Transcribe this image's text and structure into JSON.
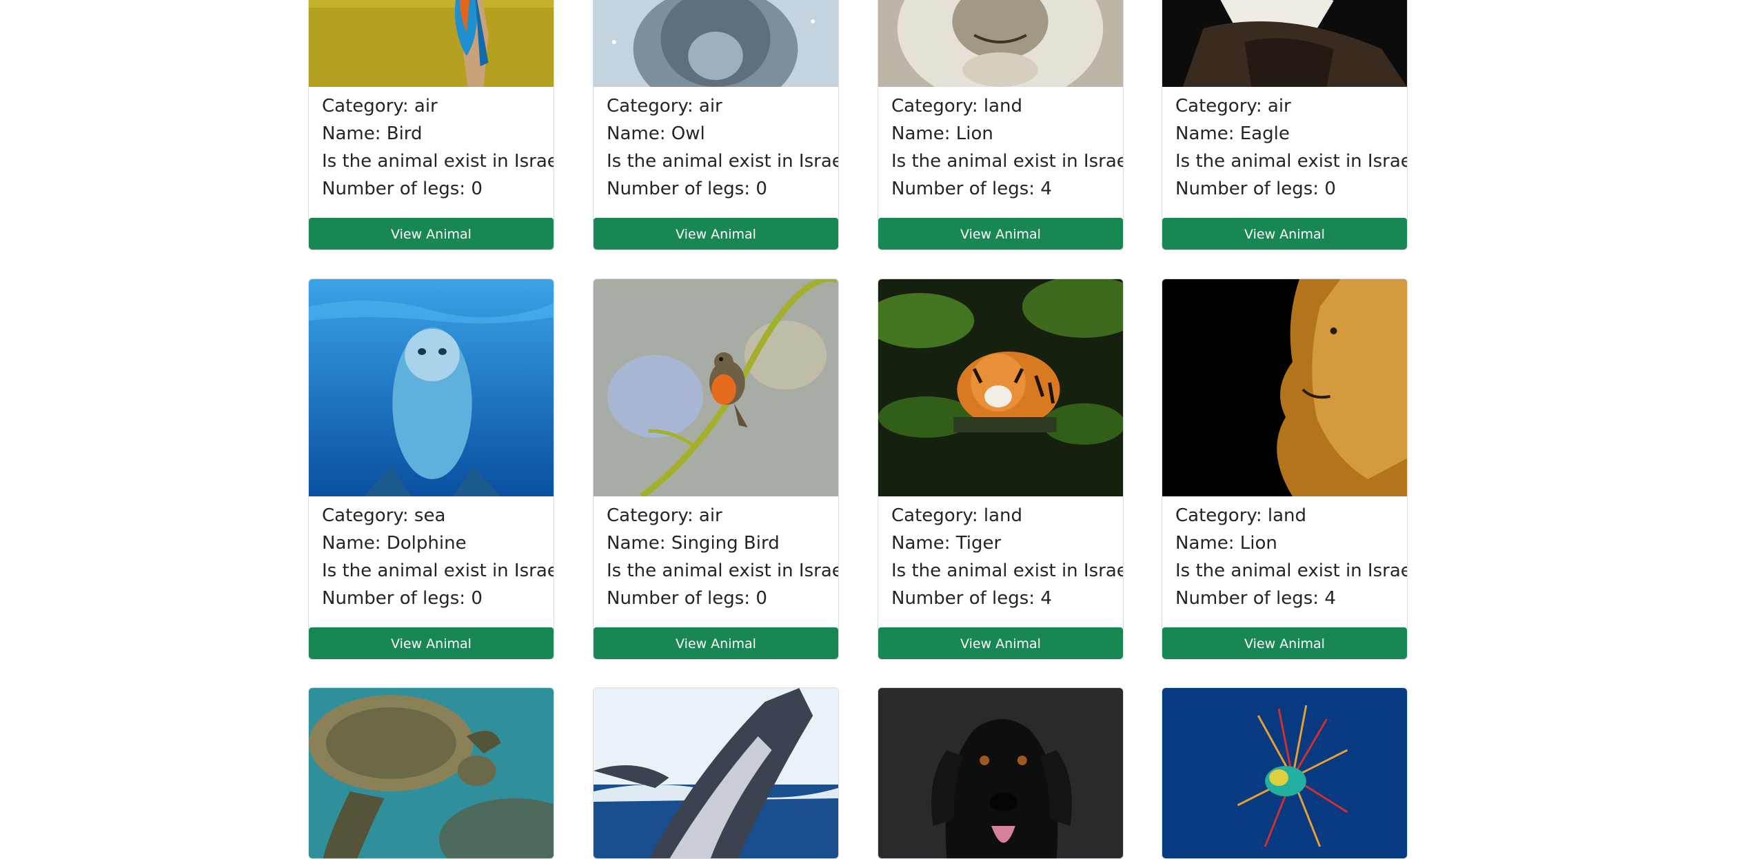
{
  "card_labels": {
    "category_prefix": "Category: ",
    "name_prefix": "Name: ",
    "exists_question": "Is the animal exist in Israel?",
    "legs_prefix": "Number of legs: ",
    "button_label": "View Animal"
  },
  "rows": [
    {
      "cards": [
        {
          "category": "Category: air",
          "name": "Name: Bird",
          "exists": "Is the animal exist in Israel?",
          "legs": "Number of legs: 0",
          "button": "View Animal",
          "image_icon": "kingfisher-bird-photo",
          "colors": [
            "#c9b52a",
            "#8a7a18"
          ]
        },
        {
          "category": "Category: air",
          "name": "Name: Owl",
          "exists": "Is the animal exist in Israel?",
          "legs": "Number of legs: 0",
          "button": "View Animal",
          "image_icon": "snowy-owl-photo",
          "colors": [
            "#b9c9d6",
            "#6c7f8e"
          ]
        },
        {
          "category": "Category: land",
          "name": "Name: Lion",
          "exists": "Is the animal exist in Israel?",
          "legs": "Number of legs: 4",
          "button": "View Animal",
          "image_icon": "lion-chin-photo",
          "colors": [
            "#d8d2c6",
            "#8a7f6e"
          ]
        },
        {
          "category": "Category: air",
          "name": "Name: Eagle",
          "exists": "Is the animal exist in Israel?",
          "legs": "Number of legs: 0",
          "button": "View Animal",
          "image_icon": "bald-eagle-photo",
          "colors": [
            "#111111",
            "#3a2c22"
          ]
        }
      ]
    },
    {
      "cards": [
        {
          "category": "Category: sea",
          "name": "Name: Dolphine",
          "exists": "Is the animal exist in Israel?",
          "legs": "Number of legs: 0",
          "button": "View Animal",
          "image_icon": "dolphin-underwater-photo",
          "colors": [
            "#2a8fd6",
            "#0b4f9e"
          ]
        },
        {
          "category": "Category: air",
          "name": "Name: Singing Bird",
          "exists": "Is the animal exist in Israel?",
          "legs": "Number of legs: 0",
          "button": "View Animal",
          "image_icon": "robin-on-branch-photo",
          "colors": [
            "#9aa7a0",
            "#6f7a73"
          ]
        },
        {
          "category": "Category: land",
          "name": "Name: Tiger",
          "exists": "Is the animal exist in Israel?",
          "legs": "Number of legs: 4",
          "button": "View Animal",
          "image_icon": "tiger-in-water-photo",
          "colors": [
            "#1d2a14",
            "#4b7a22"
          ]
        },
        {
          "category": "Category: land",
          "name": "Name: Lion",
          "exists": "Is the animal exist in Israel?",
          "legs": "Number of legs: 4",
          "button": "View Animal",
          "image_icon": "lion-profile-photo",
          "colors": [
            "#000000",
            "#b8781e"
          ]
        }
      ]
    },
    {
      "cards": [
        {
          "image_icon": "sea-turtle-photo",
          "colors": [
            "#2f8f9a",
            "#6a6a4a"
          ]
        },
        {
          "image_icon": "humpback-whale-breach-photo",
          "colors": [
            "#e9f2f7",
            "#1a4f8f"
          ]
        },
        {
          "image_icon": "black-dog-photo",
          "colors": [
            "#2a2a2c",
            "#0e0e0e"
          ]
        },
        {
          "image_icon": "lionfish-photo",
          "colors": [
            "#0a3f86",
            "#063072"
          ]
        }
      ]
    }
  ]
}
